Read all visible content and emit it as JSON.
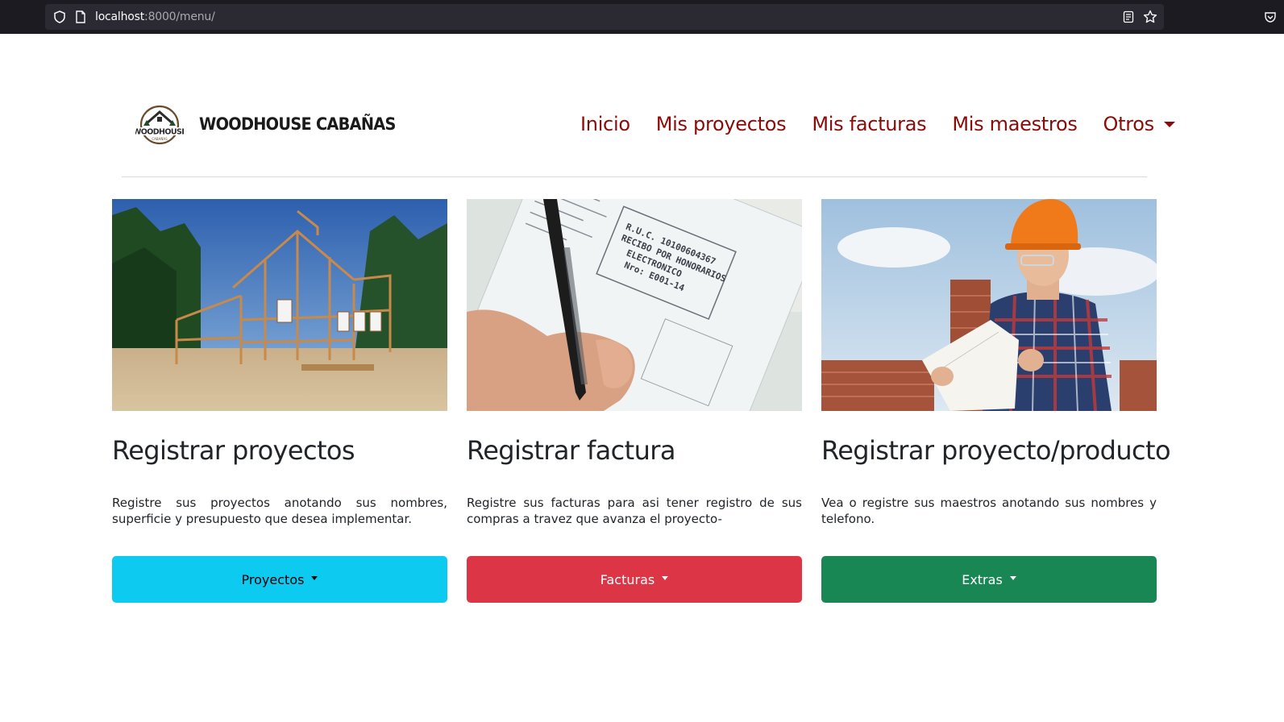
{
  "browser": {
    "url_host": "localhost",
    "url_rest": ":8000/menu/"
  },
  "brand": {
    "logo_text": "WOODHOUSE",
    "logo_subtext": "CABAÑAS",
    "name": "WOODHOUSE CABAÑAS"
  },
  "nav": {
    "items": [
      "Inicio",
      "Mis proyectos",
      "Mis facturas",
      "Mis maestros"
    ],
    "dropdown_label": "Otros"
  },
  "cards": [
    {
      "title": "Registrar proyectos",
      "text": "Registre sus proyectos anotando sus nombres, superficie y presupuesto que desea implementar.",
      "button": "Proyectos",
      "button_color": "#0dcaf0"
    },
    {
      "title": "Registrar factura",
      "text": "Registre sus facturas para asi tener registro de sus compras a travez que avanza el proyecto-",
      "button": "Facturas",
      "button_color": "#dc3545"
    },
    {
      "title": "Registrar proyecto/producto",
      "text": "Vea o registre sus maestros anotando sus nombres y telefono.",
      "button": "Extras",
      "button_color": "#198754"
    }
  ],
  "receipt": {
    "ruc": "R.U.C. 10100604367",
    "line2": "RECIBO POR HONORARIOS",
    "line3": "ELECTRONICO",
    "line4": "Nro: E001-14"
  },
  "colors": {
    "nav_link": "#8b0a0a",
    "chrome_bg": "#1c1b22",
    "urlbar_bg": "#2b2a33"
  }
}
